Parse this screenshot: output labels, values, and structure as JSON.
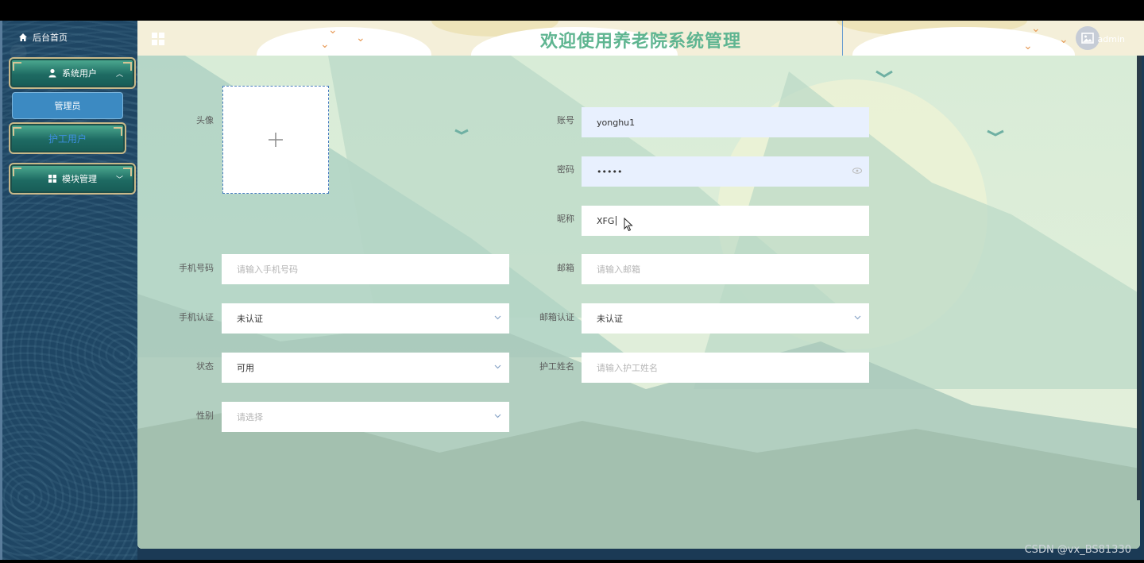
{
  "sidebar": {
    "home_label": "后台首页",
    "items": [
      {
        "label": "系统用户",
        "icon": "user-icon"
      },
      {
        "label": "护工用户",
        "icon": ""
      },
      {
        "label": "模块管理",
        "icon": "grid-icon"
      }
    ],
    "sub_item_label": "管理员"
  },
  "header": {
    "title": "欢迎使用养老院系统管理",
    "user_name": "admin",
    "avatar_icon": "image-icon"
  },
  "form": {
    "avatar_label": "头像",
    "account_label": "账号",
    "account_value": "yonghu1",
    "password_label": "密码",
    "password_value": "•••••",
    "nickname_label": "昵称",
    "nickname_value": "XFG",
    "phone_label": "手机号码",
    "phone_placeholder": "请输入手机号码",
    "email_label": "邮箱",
    "email_placeholder": "请输入邮箱",
    "phone_verify_label": "手机认证",
    "phone_verify_value": "未认证",
    "email_verify_label": "邮箱认证",
    "email_verify_value": "未认证",
    "status_label": "状态",
    "status_value": "可用",
    "caregiver_name_label": "护工姓名",
    "caregiver_name_placeholder": "请输入护工姓名",
    "gender_label": "性别",
    "gender_placeholder": "请选择"
  },
  "watermark": "CSDN @vx_BS81330",
  "colors": {
    "title": "#5fb591",
    "sub_item": "#3c8ac2",
    "menu_card": "#1e6b63"
  }
}
